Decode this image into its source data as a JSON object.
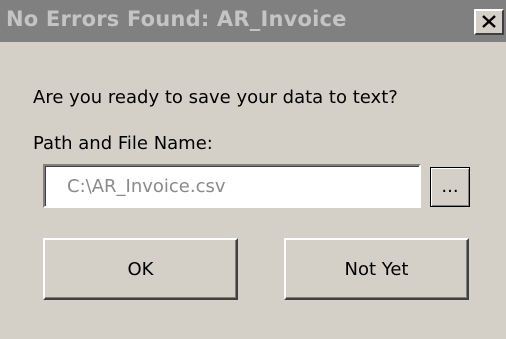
{
  "window": {
    "title": "No Errors Found: AR_Invoice"
  },
  "dialog": {
    "prompt": "Are you ready to save your data to text?",
    "path_label": "Path and File Name:",
    "path_value": "C:\\AR_Invoice.csv",
    "browse_label": "...",
    "ok_label": "OK",
    "not_yet_label": "Not Yet"
  },
  "colors": {
    "face": "#d4d0c8",
    "titlebar_inactive": "#808080",
    "title_text_inactive": "#c4c4c4",
    "input_text_disabled": "#8a8a8a"
  },
  "icons": {
    "close": "close-icon"
  }
}
